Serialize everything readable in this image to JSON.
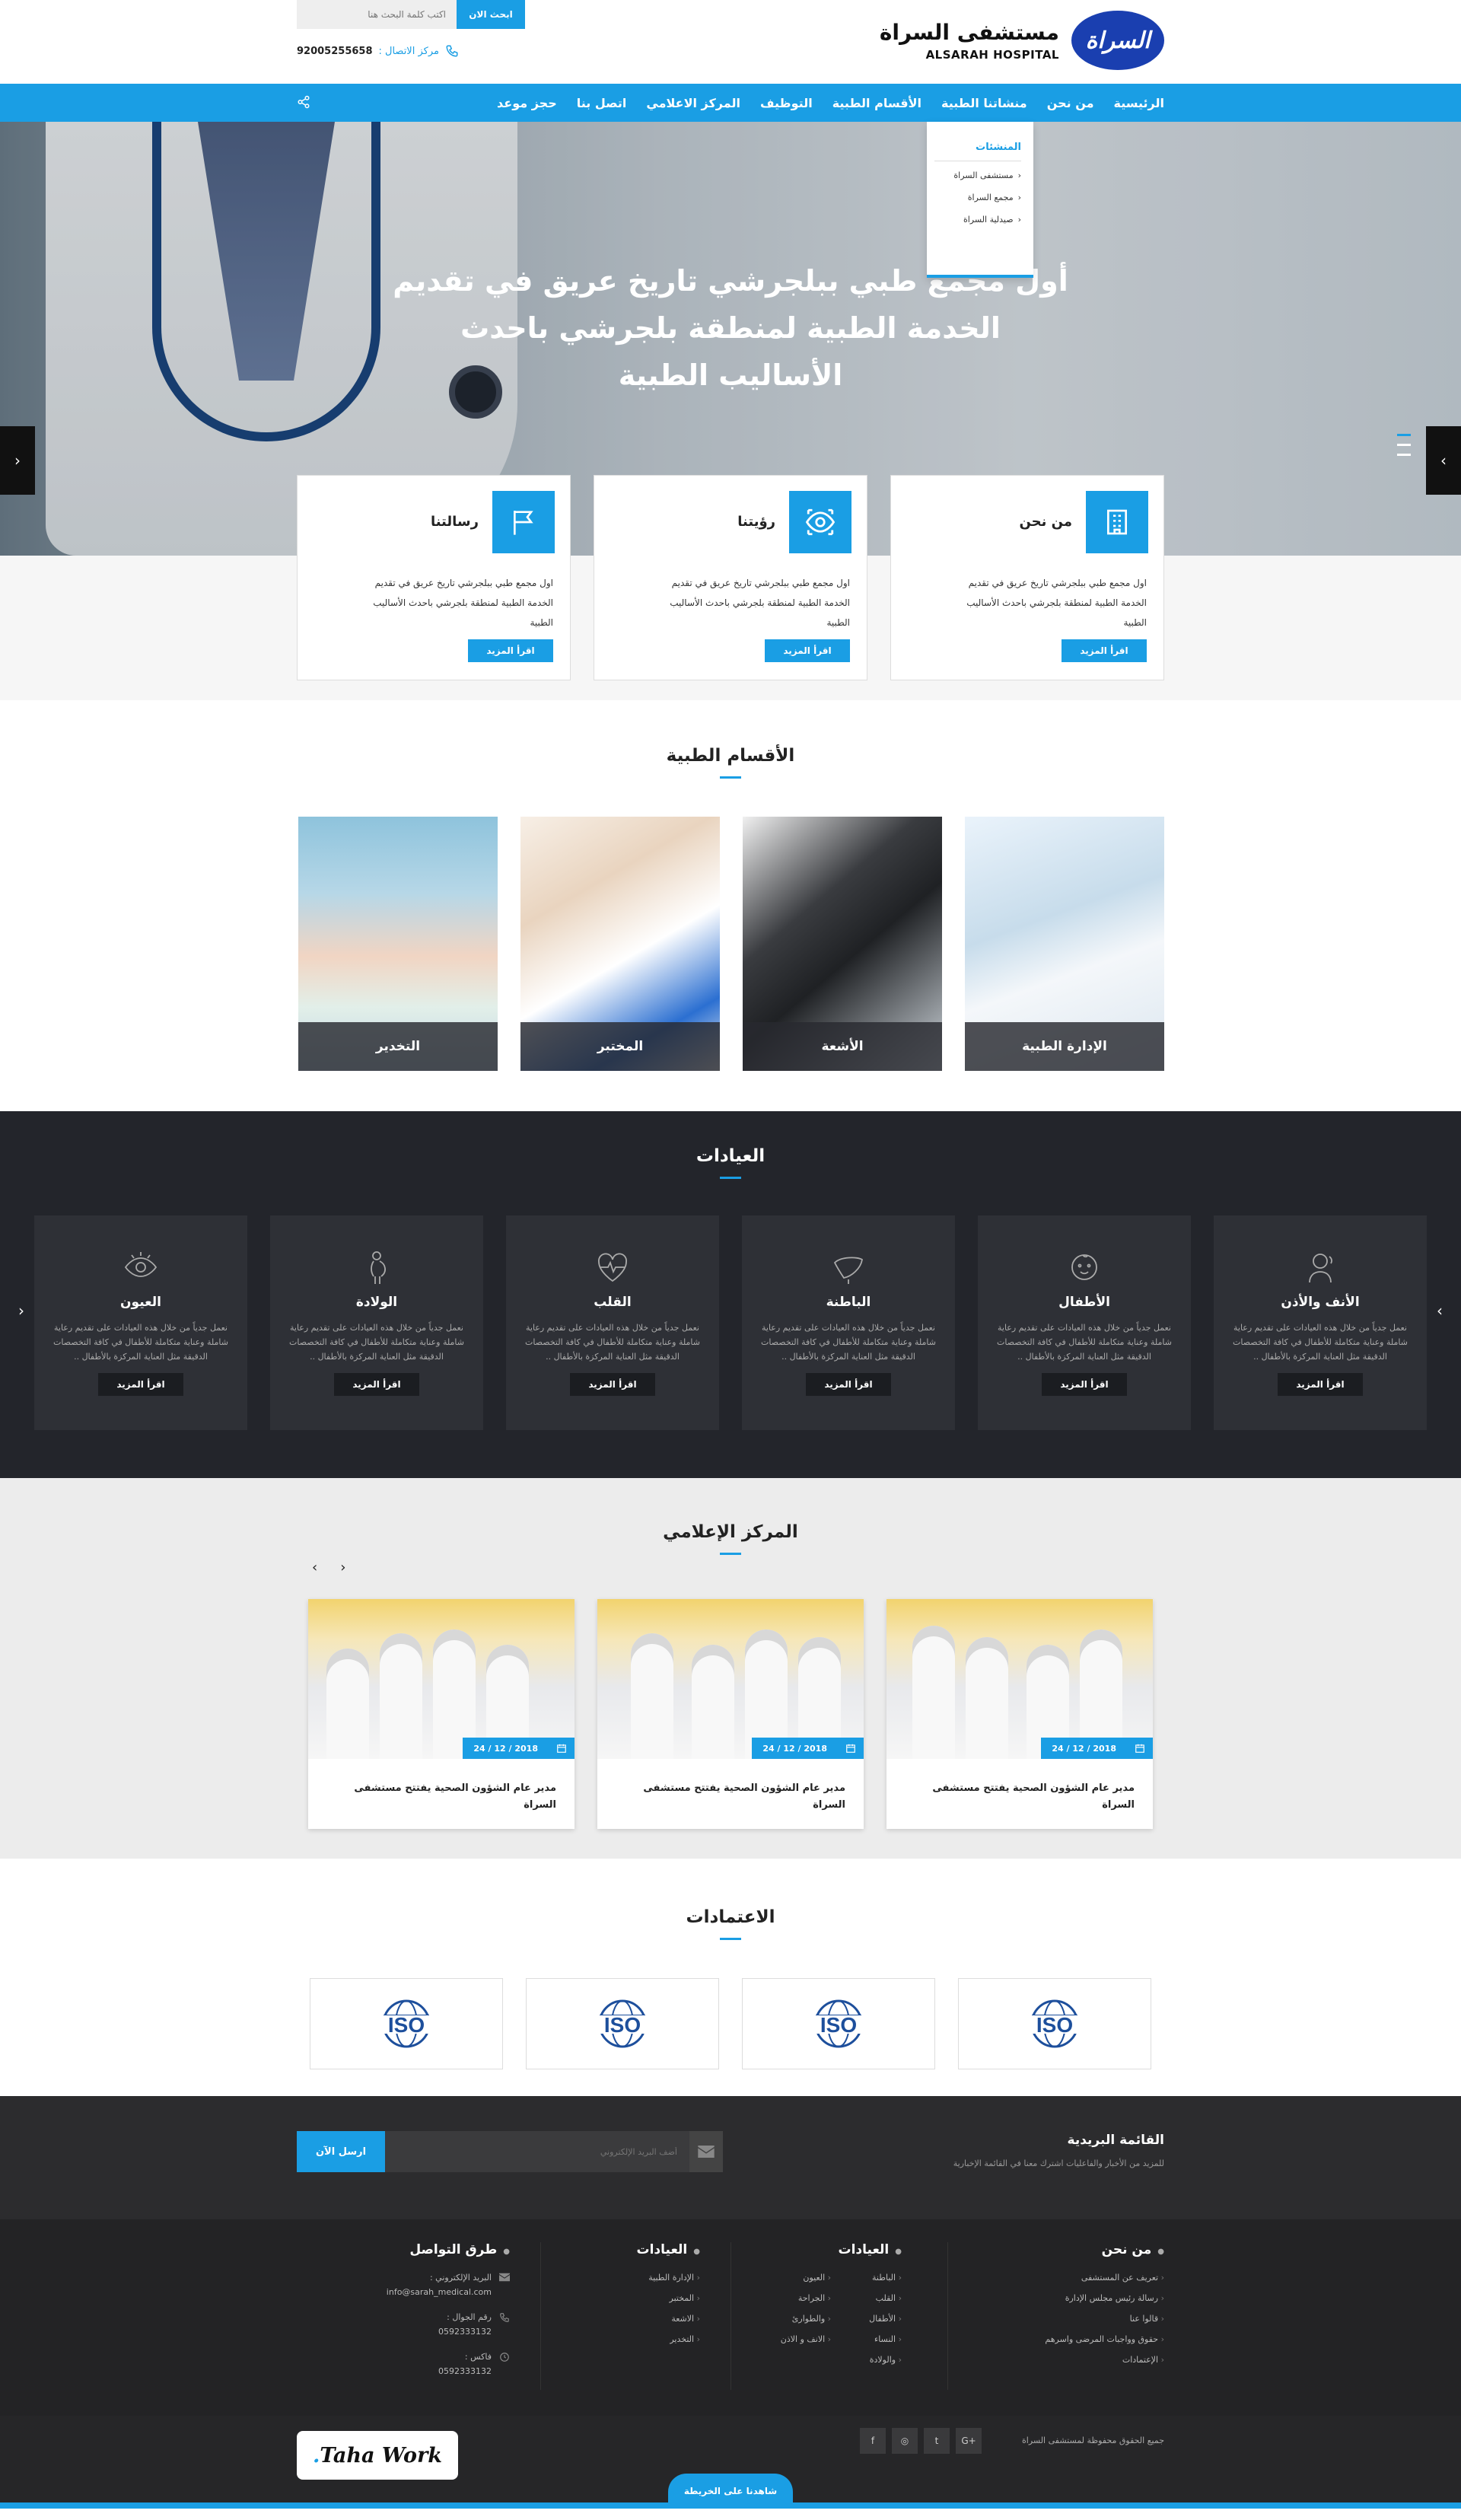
{
  "header": {
    "logo_mark": "السراة",
    "logo_ar": "مستشفى السراة",
    "logo_en": "ALSARAH HOSPITAL",
    "search_placeholder": "اكتب كلمة البحث هنا",
    "search_button": "ابحث الان",
    "call_label": "مركز الاتصال :",
    "call_number": "92005255658"
  },
  "nav": {
    "items": [
      "الرئيسية",
      "من نحن",
      "منشاتنا الطبية",
      "الأقسام الطبية",
      "التوظيف",
      "المركز الاعلامي",
      "اتصل بنا",
      "حجز موعد"
    ],
    "dropdown": {
      "heading": "المنشئات",
      "items": [
        "مستشفى السراة",
        "مجمع السراة",
        "صيدلية السراة"
      ]
    }
  },
  "hero": {
    "title_line1": "أول مجمع طبي ببلجرشي تاريخ عريق في تقديم",
    "title_line2": "الخدمة الطبية لمنطقة بلجرشي باحدث",
    "title_line3": "الأساليب الطبية"
  },
  "features": [
    {
      "title": "من نحن",
      "text": "اول مجمع طبي ببلجرشي تاريخ عريق في تقديم الخدمة الطبية لمنطقة بلجرشي باحدث الأساليب الطبية",
      "button": "اقرأ المزيد",
      "icon": "hospital-icon"
    },
    {
      "title": "رؤيتنا",
      "text": "اول مجمع طبي ببلجرشي تاريخ عريق في تقديم الخدمة الطبية لمنطقة بلجرشي باحدث الأساليب الطبية",
      "button": "اقرأ المزيد",
      "icon": "eye-icon"
    },
    {
      "title": "رسالتنا",
      "text": "اول مجمع طبي ببلجرشي تاريخ عريق في تقديم الخدمة الطبية لمنطقة بلجرشي باحدث الأساليب الطبية",
      "button": "اقرأ المزيد",
      "icon": "flag-icon"
    }
  ],
  "departments": {
    "title": "الأقسام الطبية",
    "items": [
      "الإدارة الطبية",
      "الأشعة",
      "المختبر",
      "التخدير"
    ]
  },
  "clinics": {
    "title": "العيادات",
    "items": [
      {
        "title": "الأنف والأذن",
        "text": "نعمل جدياً من خلال هذه العيادات على تقديم رعاية شاملة وعناية متكاملة للأطفال في كافة التخصصات الدقيقة مثل العناية المركزة بالأطفال ..",
        "button": "اقرأ المزيد",
        "icon": "ent-icon"
      },
      {
        "title": "الأطفال",
        "text": "نعمل جدياً من خلال هذه العيادات على تقديم رعاية شاملة وعناية متكاملة للأطفال في كافة التخصصات الدقيقة مثل العناية المركزة بالأطفال ..",
        "button": "اقرأ المزيد",
        "icon": "baby-icon"
      },
      {
        "title": "الباطنة",
        "text": "نعمل جدياً من خلال هذه العيادات على تقديم رعاية شاملة وعناية متكاملة للأطفال في كافة التخصصات الدقيقة مثل العناية المركزة بالأطفال ..",
        "button": "اقرأ المزيد",
        "icon": "liver-icon"
      },
      {
        "title": "القلب",
        "text": "نعمل جدياً من خلال هذه العيادات على تقديم رعاية شاملة وعناية متكاملة للأطفال في كافة التخصصات الدقيقة مثل العناية المركزة بالأطفال ..",
        "button": "اقرأ المزيد",
        "icon": "heart-icon"
      },
      {
        "title": "الولادة",
        "text": "نعمل جدياً من خلال هذه العيادات على تقديم رعاية شاملة وعناية متكاملة للأطفال في كافة التخصصات الدقيقة مثل العناية المركزة بالأطفال ..",
        "button": "اقرأ المزيد",
        "icon": "pregnancy-icon"
      },
      {
        "title": "العيون",
        "text": "نعمل جدياً من خلال هذه العيادات على تقديم رعاية شاملة وعناية متكاملة للأطفال في كافة التخصصات الدقيقة مثل العناية المركزة بالأطفال ..",
        "button": "اقرأ المزيد",
        "icon": "eye-icon"
      }
    ]
  },
  "media": {
    "title": "المركز الإعلامي",
    "items": [
      {
        "date": "2018 / 12 / 24",
        "title": "مدير عام الشؤون الصحية يفتتح مستشفى السراة"
      },
      {
        "date": "2018 / 12 / 24",
        "title": "مدير عام الشؤون الصحية يفتتح مستشفى السراة"
      },
      {
        "date": "2018 / 12 / 24",
        "title": "مدير عام الشؤون الصحية يفتتح مستشفى السراة"
      }
    ]
  },
  "accreditations": {
    "title": "الاعتمادات",
    "logo_text": "ISO"
  },
  "newsletter": {
    "title": "القائمة البريدية",
    "subtitle": "للمزيد من الأخبار والفاعليات اشترك معنا في القائمة الإخبارية",
    "placeholder": "أضف البريد الإلكتروني",
    "button": "ارسل الآن"
  },
  "footer": {
    "about": {
      "title": "من نحن",
      "items": [
        "تعريف عن المستشفى",
        "رسالة رئيس مجلس الإدارة",
        "قالوا عنا",
        "حقوق وواجبات المرضى واسرهم",
        "الإعتمادات"
      ]
    },
    "clinics1": {
      "title": "العيادات",
      "col1": [
        "الباطنة",
        "القلب",
        "الأطفال",
        "النساء",
        "والولادة"
      ],
      "col2": [
        "العيون",
        "الجراحة",
        "والطوارئ",
        "الانف و الاذن"
      ]
    },
    "clinics2": {
      "title": "العيادات",
      "items": [
        "الإدارة الطبية",
        "المختبر",
        "الاشعة",
        "التخدير"
      ]
    },
    "contact": {
      "title": "طرق التواصل",
      "email_label": "البريد الإلكتروني :",
      "email": "info@sarah_medical.com",
      "mobile_label": "رقم الجوال :",
      "mobile": "0592333132",
      "fax_label": "فاكس :",
      "fax": "0592333132"
    },
    "copyright": "جميع الحقوق محفوظة لمستشفى السراة",
    "credit": "Taha Work",
    "map_button": "شاهدنا على الخريطة"
  },
  "colors": {
    "accent": "#1a9ee4",
    "dark": "#23252b",
    "logo": "#1a3fb0"
  }
}
